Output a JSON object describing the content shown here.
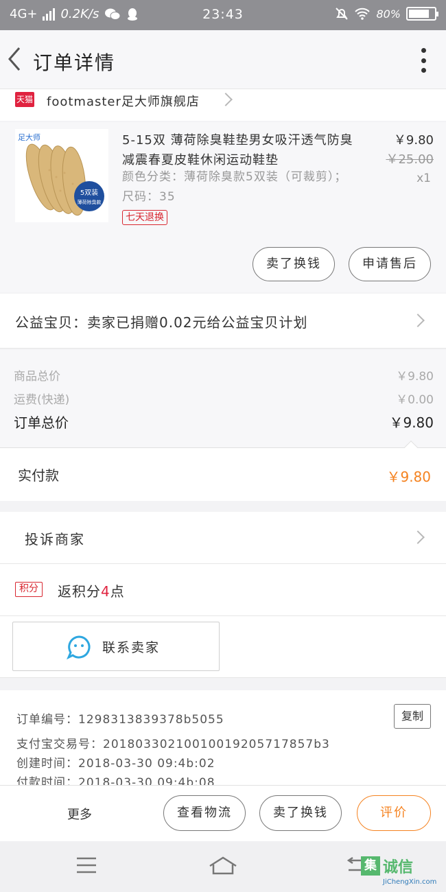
{
  "status_bar": {
    "network": "4G+",
    "speed": "0.2K/s",
    "time": "23:43",
    "battery": "80%",
    "battery_level": 0.8,
    "icons": [
      "signal-icon",
      "wechat-icon",
      "qq-icon",
      "alarm-off-icon",
      "wifi-icon",
      "battery-icon"
    ]
  },
  "header": {
    "title": "订单详情"
  },
  "shop": {
    "badge": "天猫",
    "name": "footmaster足大师旗舰店"
  },
  "product": {
    "image_brand": "足大师",
    "image_badge_line1": "5双装",
    "image_badge_line2": "薄荷除臭款",
    "title": "5-15双 薄荷除臭鞋垫男女吸汗透气防臭减震春夏皮鞋休闲运动鞋垫",
    "sku": "颜色分类：薄荷除臭款5双装（可裁剪）；尺码：35",
    "price": "￥9.80",
    "original_price": "￥25.00",
    "quantity": "x1",
    "return_tag": "七天退换",
    "buttons": {
      "sell": "卖了换钱",
      "after_sale": "申请售后"
    }
  },
  "charity": {
    "text": "公益宝贝：卖家已捐赠0.02元给公益宝贝计划"
  },
  "totals": {
    "goods_label": "商品总价",
    "goods_value": "￥9.80",
    "shipping_label": "运费(快递)",
    "shipping_value": "￥0.00",
    "order_label": "订单总价",
    "order_value": "￥9.80"
  },
  "paid": {
    "label": "实付款",
    "value": "￥9.80"
  },
  "complain": {
    "label": "投诉商家"
  },
  "points": {
    "badge": "积分",
    "prefix": "返积分",
    "number": "4",
    "suffix": "点"
  },
  "contact": {
    "label": "联系卖家"
  },
  "order_info": {
    "order_no": "订单编号：1298313839378b5055",
    "copy_label": "复制",
    "alipay_no": "支付宝交易号：20180330210010019205717857b3",
    "created": "创建时间：2018-03-30 09:4b:02",
    "paid": "付款时间：2018-03-30 09:4b:08"
  },
  "bottom_bar": {
    "more": "更多",
    "logistics": "查看物流",
    "sell": "卖了换钱",
    "review": "评价"
  },
  "watermark": {
    "char1": "集",
    "text": "诚信",
    "sub": "JiChengXin.com"
  },
  "colors": {
    "accent": "#f5821f",
    "tmall_red": "#e0223f",
    "status_bar": "#8f8f93"
  }
}
